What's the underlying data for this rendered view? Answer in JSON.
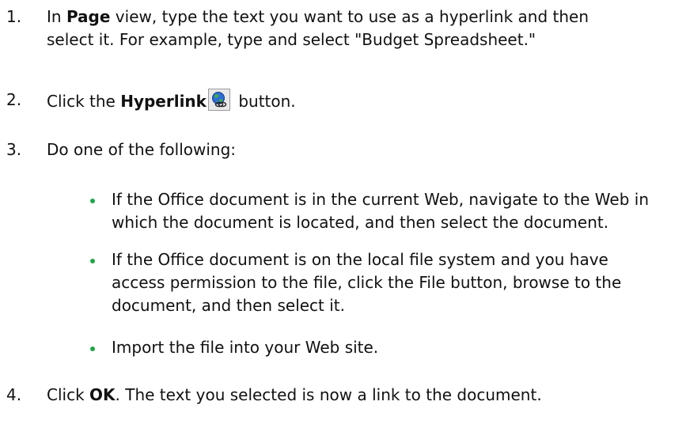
{
  "steps": [
    {
      "number": "1.",
      "pre": "In ",
      "bold": "Page",
      "post": " view, type the text you want to use as a hyperlink and then select it. For example, type and select \"Budget Spreadsheet.\""
    },
    {
      "number": "2.",
      "pre": "Click the ",
      "bold": "Hyperlink",
      "post": " button.",
      "icon": "hyperlink-globe-icon"
    },
    {
      "number": "3.",
      "text": "Do one of the following:",
      "bullets": [
        "If the Office document is in the current Web, navigate to the Web in which the document is located, and then select the document.",
        "If the Office document is on the local file system and you have access permission to the file, click the File button, browse to the document, and then select it.",
        "Import the file into your Web site."
      ]
    },
    {
      "number": "4.",
      "pre": "Click ",
      "bold": "OK",
      "post": ". The text you selected is now a link to the document."
    }
  ],
  "colors": {
    "bullet": "#22a54a",
    "text": "#111111"
  }
}
